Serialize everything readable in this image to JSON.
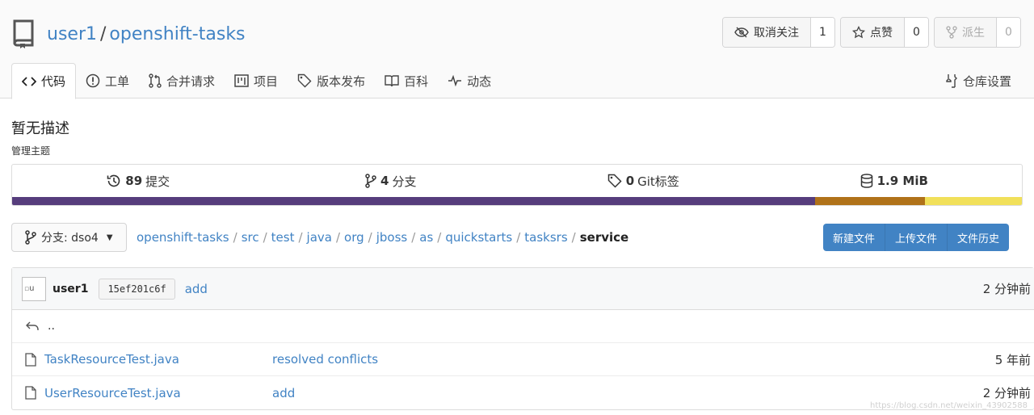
{
  "repo": {
    "owner": "user1",
    "separator": "/",
    "name": "openshift-tasks"
  },
  "actions": {
    "unwatch": {
      "label": "取消关注",
      "count": "1"
    },
    "star": {
      "label": "点赞",
      "count": "0"
    },
    "fork": {
      "label": "派生",
      "count": "0"
    }
  },
  "tabs": [
    {
      "label": "代码",
      "icon": "code-icon"
    },
    {
      "label": "工单",
      "icon": "issue-icon"
    },
    {
      "label": "合并请求",
      "icon": "pull-request-icon"
    },
    {
      "label": "项目",
      "icon": "project-icon"
    },
    {
      "label": "版本发布",
      "icon": "tag-icon"
    },
    {
      "label": "百科",
      "icon": "book-icon"
    },
    {
      "label": "动态",
      "icon": "pulse-icon"
    }
  ],
  "settings_tab": "仓库设置",
  "description": "暂无描述",
  "manage_topics": "管理主题",
  "stats": {
    "commits": {
      "value": "89",
      "label": "提交"
    },
    "branches": {
      "value": "4",
      "label": "分支"
    },
    "tags": {
      "value": "0",
      "label": "Git标签"
    },
    "size": {
      "value": "1.9 MiB"
    }
  },
  "language_bar": [
    {
      "color": "#563d7c",
      "percent": 79.5
    },
    {
      "color": "#b07219",
      "percent": 10.9
    },
    {
      "color": "#f1e05a",
      "percent": 9.6
    }
  ],
  "branch_selector": {
    "label": "分支: dso4"
  },
  "breadcrumb": {
    "parts": [
      "openshift-tasks",
      "src",
      "test",
      "java",
      "org",
      "jboss",
      "as",
      "quickstarts",
      "tasksrs"
    ],
    "current": "service"
  },
  "file_actions": {
    "new_file": "新建文件",
    "upload": "上传文件",
    "history": "文件历史"
  },
  "latest_commit": {
    "avatar_alt": "u",
    "user": "user1",
    "sha": "15ef201c6f",
    "message": "add",
    "time": "2 分钟前"
  },
  "parent_dir": "..",
  "files": [
    {
      "name": "TaskResourceTest.java",
      "message": "resolved conflicts",
      "time": "5 年前"
    },
    {
      "name": "UserResourceTest.java",
      "message": "add",
      "time": "2 分钟前"
    }
  ],
  "watermark": "https://blog.csdn.net/weixin_43902588"
}
